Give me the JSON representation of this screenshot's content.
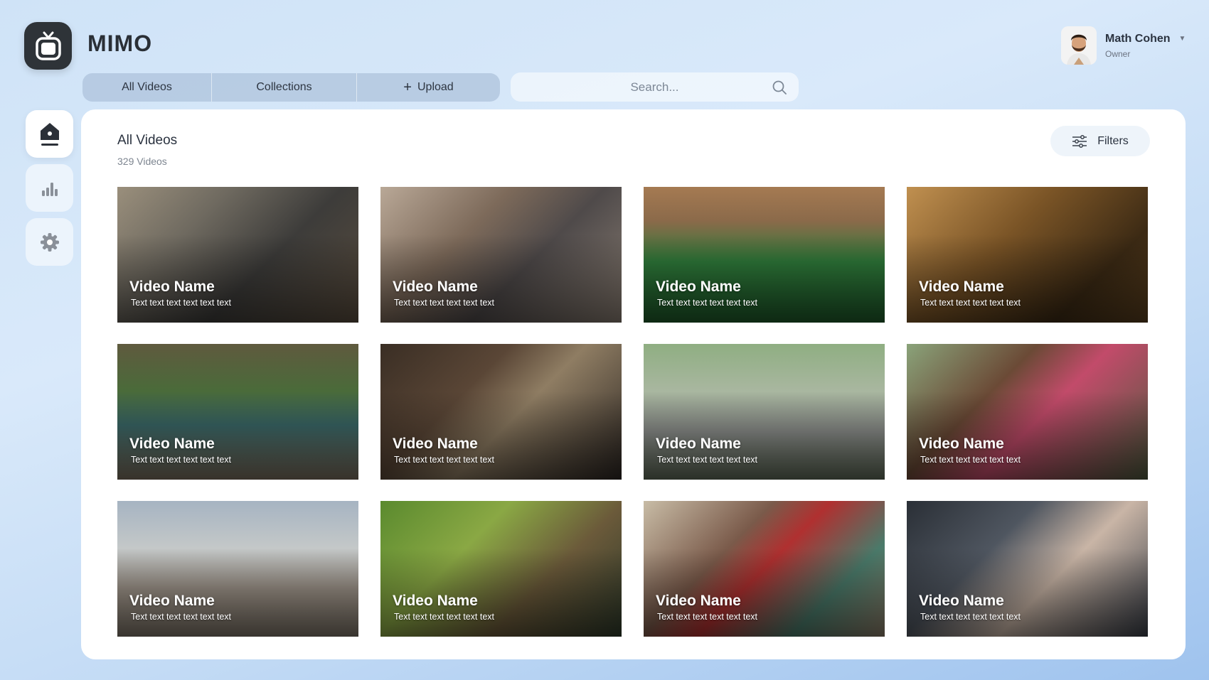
{
  "brand": {
    "name": "MIMO"
  },
  "profile": {
    "name": "Math Cohen",
    "role": "Owner"
  },
  "tabs": [
    {
      "label": "All Videos"
    },
    {
      "label": "Collections"
    },
    {
      "label": "Upload",
      "icon": "plus-icon"
    }
  ],
  "search": {
    "placeholder": "Search..."
  },
  "sidenav": [
    {
      "icon": "home-icon",
      "active": true
    },
    {
      "icon": "bar-chart-icon",
      "active": false
    },
    {
      "icon": "gear-icon",
      "active": false
    }
  ],
  "panel": {
    "title": "All Videos",
    "count": "329 Videos",
    "filters_label": "Filters"
  },
  "videos": [
    {
      "name": "Video Name",
      "desc": "Text text text text text text",
      "bg": "linear-gradient(135deg,#9a8f7c 0%,#6f6a60 30%,#3d3c3a 60%,#5a4d3e 100%)"
    },
    {
      "name": "Video Name",
      "desc": "Text text text text text text",
      "bg": "linear-gradient(135deg,#b9a897 0%,#7d6a5a 35%,#4f4a4a 60%,#8a7e73 100%)"
    },
    {
      "name": "Video Name",
      "desc": "Text text text text text text",
      "bg": "linear-gradient(180deg,#a57a52 0%,#8b6a4a 25%,#2f7b3a 55%,#1e5a2a 100%)"
    },
    {
      "name": "Video Name",
      "desc": "Text text text text text text",
      "bg": "linear-gradient(135deg,#c09050 0%,#7a5426 40%,#3c2a14 75%,#5a3f1e 100%)"
    },
    {
      "name": "Video Name",
      "desc": "Text text text text text text",
      "bg": "linear-gradient(180deg,#5f5a3e 0%,#4a6b3a 35%,#3b6a6a 60%,#7b6f5e 100%)"
    },
    {
      "name": "Video Name",
      "desc": "Text text text text text text",
      "bg": "linear-gradient(135deg,#3a2e24 0%,#5a4636 35%,#8f7d63 55%,#2c2622 100%)"
    },
    {
      "name": "Video Name",
      "desc": "Text text text text text text",
      "bg": "linear-gradient(180deg,#8fae82 0%,#a9b7a0 35%,#8e918e 65%,#5f6b58 100%)"
    },
    {
      "name": "Video Name",
      "desc": "Text text text text text text",
      "bg": "linear-gradient(135deg,#8aa37a 0%,#6b4a36 35%,#c24b6a 55%,#4e5a3e 100%)"
    },
    {
      "name": "Video Name",
      "desc": "Text text text text text text",
      "bg": "linear-gradient(180deg,#a6b4c2 0%,#c4c8c8 35%,#9f958a 65%,#7d7468 100%)"
    },
    {
      "name": "Video Name",
      "desc": "Text text text text text text",
      "bg": "linear-gradient(135deg,#5a8a2e 0%,#8aa844 35%,#6b5a3a 65%,#2e3a2a 100%)"
    },
    {
      "name": "Video Name",
      "desc": "Text text text text text text",
      "bg": "linear-gradient(135deg,#c8bca6 0%,#7a5a4a 35%,#b03030 50%,#4a7a6a 75%,#8a7a66 100%)"
    },
    {
      "name": "Video Name",
      "desc": "Text text text text text text",
      "bg": "linear-gradient(135deg,#2a2f36 0%,#4f5660 35%,#c9b5a6 60%,#3a3f48 100%)"
    }
  ]
}
